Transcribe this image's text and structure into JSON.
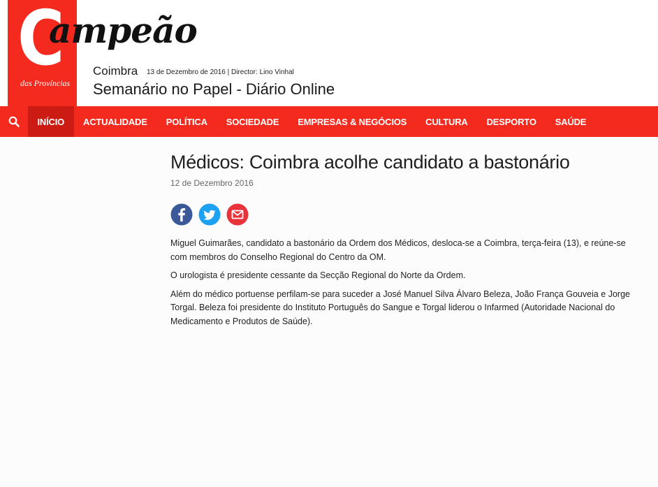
{
  "header": {
    "logo_letter": "C",
    "logo_word": "ampeão",
    "logo_sub": "das Províncias",
    "city": "Coimbra",
    "issue_info": "13 de Dezembro de 2016 | Director: Lino Vinhal",
    "tagline": "Semanário no Papel - Diário Online"
  },
  "nav": {
    "search_icon": "search-icon",
    "items": [
      {
        "label": "INÍCIO"
      },
      {
        "label": "ACTUALIDADE"
      },
      {
        "label": "POLÍTICA"
      },
      {
        "label": "SOCIEDADE"
      },
      {
        "label": "EMPRESAS & NEGÓCIOS"
      },
      {
        "label": "CULTURA"
      },
      {
        "label": "DESPORTO"
      },
      {
        "label": "SAÚDE"
      }
    ],
    "active_index": 0
  },
  "article": {
    "title": "Médicos: Coimbra acolhe candidato a bastonário",
    "date": "12 de Dezembro 2016",
    "share": [
      {
        "icon": "facebook-icon",
        "color": "#3b5998"
      },
      {
        "icon": "twitter-icon",
        "color": "#1da1f2"
      },
      {
        "icon": "email-icon",
        "color": "#e8333b"
      }
    ],
    "paragraphs": [
      "Miguel Guimarães, candidato a bastonário da Ordem dos Médicos, desloca-se a Coimbra, terça-feira (13), e reúne-se com membros do Conselho Regional do Centro da OM.",
      "O urologista é presidente cessante da Secção Regional do Norte da Ordem.",
      "Além do médico portuense perfilam-se para suceder a José Manuel Silva Álvaro Beleza, João França Gouveia e Jorge Torgal. Beleza foi presidente do Instituto Português do Sangue e Torgal liderou o Infarmed (Autoridade Nacional do Medicamento e Produtos de Saúde)."
    ]
  },
  "colors": {
    "brand_red": "#f42a1e",
    "nav_active": "#cc1b12"
  }
}
